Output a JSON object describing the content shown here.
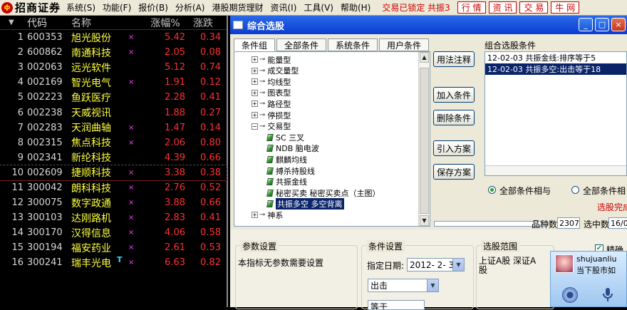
{
  "menubar": {
    "logo_mark": "ф",
    "logo_text": "招商证券",
    "items": [
      "系统(S)",
      "功能(F)",
      "报价(B)",
      "分析(A)",
      "港股期货理财",
      "资讯(I)",
      "工具(V)",
      "帮助(H)"
    ],
    "lock_status": "交易已锁定 共振3",
    "quick_buttons": [
      "行 情",
      "资 讯",
      "交 易",
      "牛 网"
    ]
  },
  "stock_table": {
    "header": {
      "arrow": "▼",
      "code": "代码",
      "name": "名称",
      "change_pct": "涨幅%",
      "change": "涨跌"
    },
    "rows": [
      {
        "idx": "1",
        "code": "600353",
        "name": "旭光股份",
        "mark": "×",
        "chg_pct": "5.42",
        "chg": "0.34"
      },
      {
        "idx": "2",
        "code": "600862",
        "name": "南通科技",
        "mark": "×",
        "chg_pct": "2.05",
        "chg": "0.08"
      },
      {
        "idx": "3",
        "code": "002063",
        "name": "远光软件",
        "mark": "",
        "chg_pct": "5.12",
        "chg": "0.74"
      },
      {
        "idx": "4",
        "code": "002169",
        "name": "智光电气",
        "mark": "×",
        "chg_pct": "1.91",
        "chg": "0.12"
      },
      {
        "idx": "5",
        "code": "002223",
        "name": "鱼跃医疗",
        "mark": "",
        "chg_pct": "2.28",
        "chg": "0.41"
      },
      {
        "idx": "6",
        "code": "002238",
        "name": "天威视讯",
        "mark": "",
        "chg_pct": "1.88",
        "chg": "0.27"
      },
      {
        "idx": "7",
        "code": "002283",
        "name": "天润曲轴",
        "mark": "×",
        "chg_pct": "1.47",
        "chg": "0.14"
      },
      {
        "idx": "8",
        "code": "002315",
        "name": "焦点科技",
        "mark": "×",
        "chg_pct": "2.06",
        "chg": "0.80"
      },
      {
        "idx": "9",
        "code": "002341",
        "name": "新纶科技",
        "mark": "",
        "chg_pct": "4.39",
        "chg": "0.66"
      },
      {
        "idx": "10",
        "code": "002609",
        "name": "捷顺科技",
        "mark": "×",
        "chg_pct": "3.38",
        "chg": "0.38"
      },
      {
        "idx": "11",
        "code": "300042",
        "name": "朗科科技",
        "mark": "×",
        "chg_pct": "2.76",
        "chg": "0.52"
      },
      {
        "idx": "12",
        "code": "300075",
        "name": "数字政通",
        "mark": "×",
        "chg_pct": "3.88",
        "chg": "0.66"
      },
      {
        "idx": "13",
        "code": "300103",
        "name": "达刚路机",
        "mark": "×",
        "chg_pct": "2.83",
        "chg": "0.41"
      },
      {
        "idx": "14",
        "code": "300170",
        "name": "汉得信息",
        "mark": "×",
        "chg_pct": "4.06",
        "chg": "0.58"
      },
      {
        "idx": "15",
        "code": "300194",
        "name": "福安药业",
        "mark": "×",
        "chg_pct": "2.61",
        "chg": "0.53"
      },
      {
        "idx": "16",
        "code": "300241",
        "name": "瑞丰光电",
        "mark": "×",
        "t_mark": "T",
        "chg_pct": "6.63",
        "chg": "0.82"
      }
    ]
  },
  "dialog": {
    "title": "综合选股",
    "window_buttons": [
      "_",
      "□",
      "×"
    ],
    "tabs": [
      "条件组",
      "全部条件",
      "系统条件",
      "用户条件"
    ],
    "tree": [
      {
        "type": "group",
        "expander": "+",
        "connector": "⊸",
        "label": "能量型"
      },
      {
        "type": "group",
        "expander": "+",
        "connector": "⊸",
        "label": "成交量型"
      },
      {
        "type": "group",
        "expander": "+",
        "connector": "⊸",
        "label": "均线型"
      },
      {
        "type": "group",
        "expander": "+",
        "connector": "⊸",
        "label": "图表型"
      },
      {
        "type": "group",
        "expander": "+",
        "connector": "⊸",
        "label": "路径型"
      },
      {
        "type": "group",
        "expander": "+",
        "connector": "⊸",
        "label": "停损型"
      },
      {
        "type": "group",
        "expander": "−",
        "connector": "⊸",
        "label": "交易型"
      },
      {
        "type": "leaf",
        "label": "SC 三叉"
      },
      {
        "type": "leaf",
        "label": "NDB 脑电波"
      },
      {
        "type": "leaf",
        "label": "麒麟均线"
      },
      {
        "type": "leaf",
        "label": "搏杀持股线"
      },
      {
        "type": "leaf",
        "label": "共振金线"
      },
      {
        "type": "leaf",
        "label": "秘密买卖 秘密买卖点（主图）"
      },
      {
        "type": "leaf",
        "label": "共振多空 多空背离",
        "selected": true
      },
      {
        "type": "group",
        "expander": "+",
        "connector": "⊸",
        "label": "神系"
      }
    ],
    "tree_scroll": {
      "up": "▲",
      "down": "▼"
    },
    "buttons": {
      "help": "用法注释",
      "add": "加入条件",
      "delete": "删除条件",
      "import": "引入方案",
      "save": "保存方案"
    },
    "combo_label": "组合选股条件",
    "conditions": [
      {
        "text": "12-02-03 共振金线:排序等于5",
        "selected": false
      },
      {
        "text": "12-02-03 共振多空:出击等于18",
        "selected": true
      }
    ],
    "logic": {
      "and_label": "全部条件相与",
      "or_label": "全部条件相"
    },
    "finished_label": "选股完成",
    "count": {
      "label": "品种数",
      "value": "2307",
      "selected_label": "选中数",
      "selected_value": "16/0"
    },
    "params": {
      "title": "参数设置",
      "text": "本指标无参数需要设置"
    },
    "cond_settings": {
      "title": "条件设置",
      "date_label": "指定日期:",
      "date_value": "2012- 2- 3",
      "action_value": "出击",
      "third_value": "等于"
    },
    "range": {
      "title": "选股范围",
      "text": "上证A股 深证A股"
    },
    "checkbox_label": "精确"
  },
  "qq_popup": {
    "user": "shujuanliu",
    "status": "当下股市如"
  }
}
